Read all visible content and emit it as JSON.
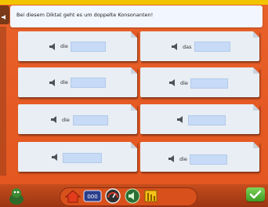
{
  "instruction": {
    "text": "Bei diesem Diktat geht es um doppelte Konsonanten!"
  },
  "cards": [
    {
      "article": "die"
    },
    {
      "article": "das"
    },
    {
      "article": "die"
    },
    {
      "article": "die"
    },
    {
      "article": "die"
    },
    {
      "article": ""
    },
    {
      "article": ""
    },
    {
      "article": "die"
    }
  ],
  "toolbar": {
    "items": [
      "home-icon",
      "keyboard-icon",
      "gauge-icon",
      "speaker-icon",
      "book-icon"
    ],
    "check_icon": "checkmark-icon"
  },
  "colors": {
    "background": "#e55a24",
    "card": "#e8eef4",
    "input": "#c7dbf7",
    "banner": "#f2f6ff",
    "check_button": "#4cab2c"
  }
}
